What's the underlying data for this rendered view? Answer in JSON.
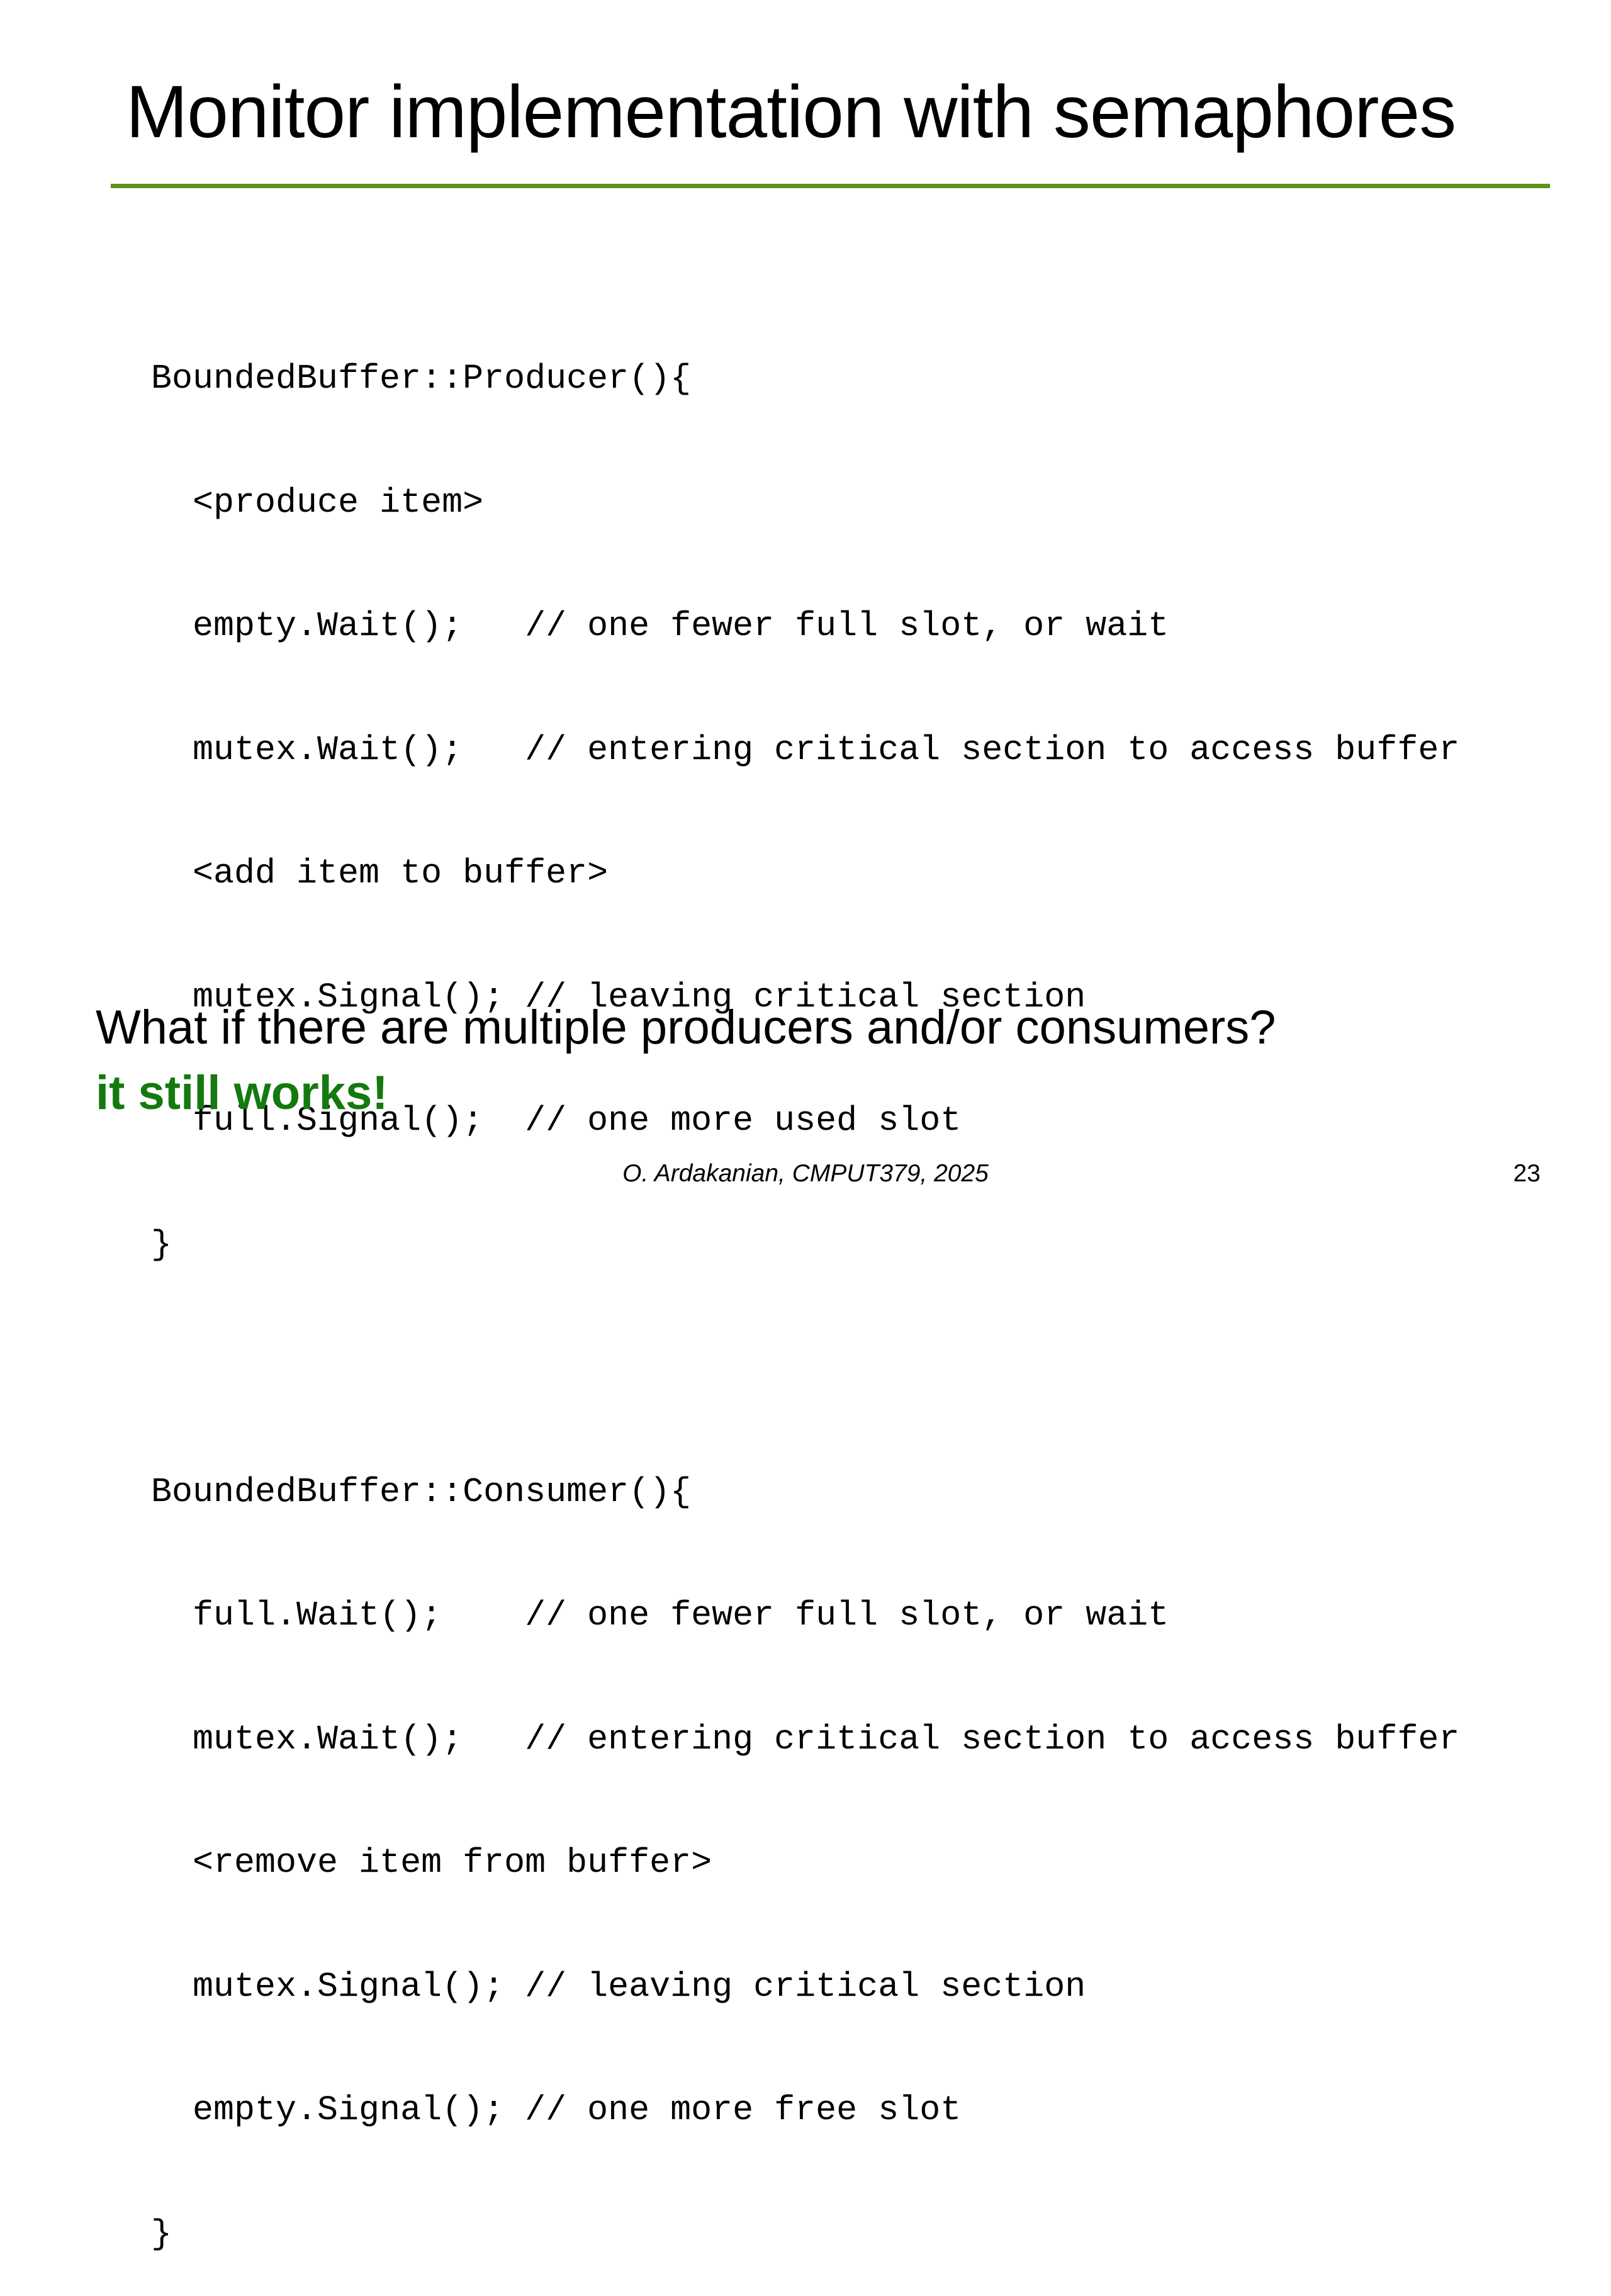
{
  "slide": {
    "title": "Monitor implementation with semaphores",
    "code_lines": [
      "BoundedBuffer::Producer(){",
      "  <produce item>",
      "  empty.Wait();   // one fewer full slot, or wait",
      "  mutex.Wait();   // entering critical section to access buffer",
      "  <add item to buffer>",
      "  mutex.Signal(); // leaving critical section",
      "  full.Signal();  // one more used slot",
      "}",
      "",
      "BoundedBuffer::Consumer(){",
      "  full.Wait();    // one fewer full slot, or wait",
      "  mutex.Wait();   // entering critical section to access buffer",
      "  <remove item from buffer>",
      "  mutex.Signal(); // leaving critical section",
      "  empty.Signal(); // one more free slot",
      "}"
    ],
    "question": "What if there are multiple producers and/or consumers?",
    "answer": "it still works!",
    "footer": "O. Ardakanian, CMPUT379, 2025",
    "page_number": "23"
  },
  "colors": {
    "rule": "#5b9417",
    "answer": "#147a0f",
    "text": "#000000",
    "background": "#ffffff"
  }
}
